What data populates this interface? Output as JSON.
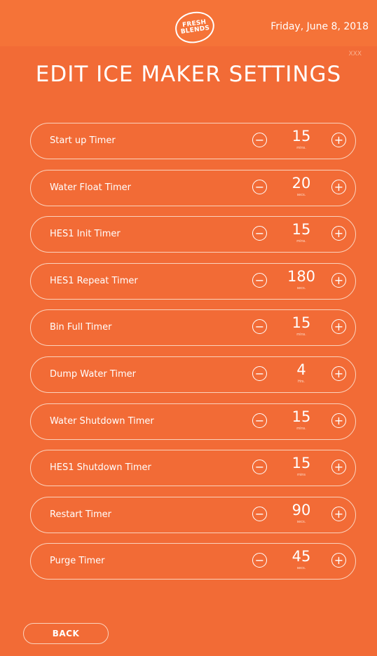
{
  "header": {
    "logo": {
      "line1": "FRESH",
      "line2": "BLENDS"
    },
    "date": "Friday, June 8, 2018",
    "code": "XXX"
  },
  "page_title": "EDIT ICE MAKER SETTINGS",
  "timers": [
    {
      "label": "Start up Timer",
      "value": "15",
      "unit": "mins."
    },
    {
      "label": "Water Float Timer",
      "value": "20",
      "unit": "secs."
    },
    {
      "label": "HES1 Init Timer",
      "value": "15",
      "unit": "mins."
    },
    {
      "label": "HES1 Repeat Timer",
      "value": "180",
      "unit": "secs."
    },
    {
      "label": "Bin Full Timer",
      "value": "15",
      "unit": "mins."
    },
    {
      "label": "Dump Water Timer",
      "value": "4",
      "unit": "Hrs."
    },
    {
      "label": "Water Shutdown Timer",
      "value": "15",
      "unit": "mins."
    },
    {
      "label": "HES1 Shutdown Timer",
      "value": "15",
      "unit": "mins"
    },
    {
      "label": "Restart Timer",
      "value": "90",
      "unit": "secs."
    },
    {
      "label": "Purge Timer",
      "value": "45",
      "unit": "secs."
    }
  ],
  "icons": {
    "decrement": "minus-circle-icon",
    "increment": "plus-circle-icon"
  },
  "footer": {
    "back_label": "BACK"
  },
  "colors": {
    "background": "#f26b36",
    "header": "#f57338",
    "text": "#ffffff"
  }
}
